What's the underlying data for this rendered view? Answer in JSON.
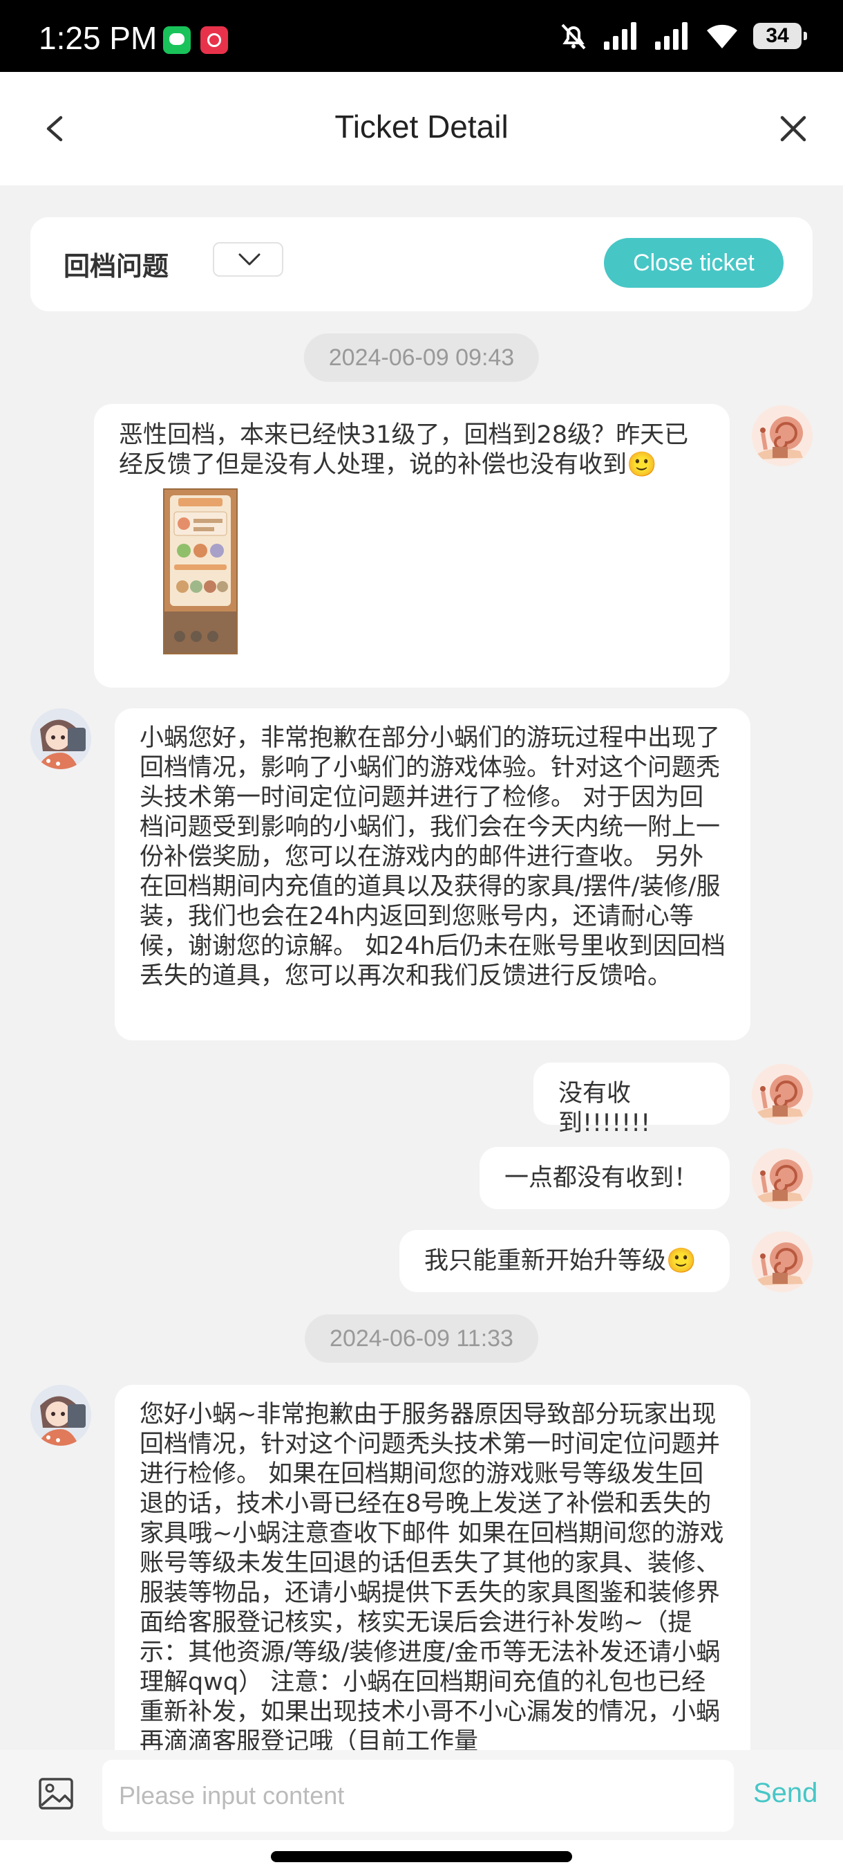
{
  "status_bar": {
    "time": "1:25 PM",
    "battery": "34"
  },
  "header": {
    "title": "Ticket Detail"
  },
  "topic": {
    "label": "回档问题",
    "close_ticket": "Close ticket"
  },
  "timestamps": [
    "2024-06-09 09:43",
    "2024-06-09 11:33"
  ],
  "messages": [
    {
      "from": "user",
      "text": "恶性回档，本来已经快31级了，回档到28级？昨天已经反馈了但是没有人处理，说的补偿也没有收到🙂",
      "has_image": true
    },
    {
      "from": "staff",
      "text": "小蜗您好，非常抱歉在部分小蜗们的游玩过程中出现了回档情况，影响了小蜗们的游戏体验。针对这个问题秃头技术第一时间定位问题并进行了检修。 对于因为回档问题受到影响的小蜗们，我们会在今天内统一附上一份补偿奖励，您可以在游戏内的邮件进行查收。 另外在回档期间内充值的道具以及获得的家具/摆件/装修/服装，我们也会在24h内返回到您账号内，还请耐心等候，谢谢您的谅解。 如24h后仍未在账号里收到因回档丢失的道具，您可以再次和我们反馈进行反馈哈。"
    },
    {
      "from": "user",
      "text": "没有收到!!!!!!!"
    },
    {
      "from": "user",
      "text": "一点都没有收到！"
    },
    {
      "from": "user",
      "text": "我只能重新开始升等级🙂"
    },
    {
      "from": "staff",
      "text": "您好小蜗~非常抱歉由于服务器原因导致部分玩家出现回档情况，针对这个问题秃头技术第一时间定位问题并进行检修。 如果在回档期间您的游戏账号等级发生回退的话，技术小哥已经在8号晚上发送了补偿和丢失的家具哦~小蜗注意查收下邮件 如果在回档期间您的游戏账号等级未发生回退的话但丢失了其他的家具、装修、服装等物品，还请小蜗提供下丢失的家具图鉴和装修界面给客服登记核实，核实无误后会进行补发哟~（提示：其他资源/等级/装修进度/金币等无法补发还请小蜗理解qwq） 注意：小蜗在回档期间充值的礼包也已经重新补发，如果出现技术小哥不小心漏发的情况，小蜗再滴滴客服登记哦（目前工作量"
    }
  ],
  "composer": {
    "placeholder": "Please input content",
    "send": "Send"
  }
}
